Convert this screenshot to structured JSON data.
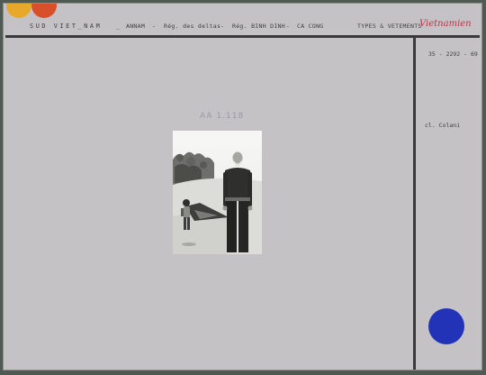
{
  "header": {
    "country": "SUD VIET_NAM",
    "region": "ANNAM",
    "sub_region_1": "Rég. des deltas",
    "sub_region_2": "Rég. BINH DINH",
    "place": "CA CONG",
    "topic": "TYPES & VETEMENTS",
    "handwritten": "Vietnamien",
    "separators": [
      "_",
      "-",
      "-",
      "-"
    ]
  },
  "reference_number": "35 - 2292 - 69",
  "credit": "cl. Colani",
  "pencil_note": "AA 1.118",
  "photo": {
    "subject": "elderly-man-and-child-on-sand"
  },
  "colors": {
    "card": "#c4c2c5",
    "background": "#4f5a52",
    "dot_yellow": "#e8a92a",
    "dot_orange": "#d8502a",
    "dot_blue": "#2233b8",
    "handwriting": "#c0344a"
  }
}
